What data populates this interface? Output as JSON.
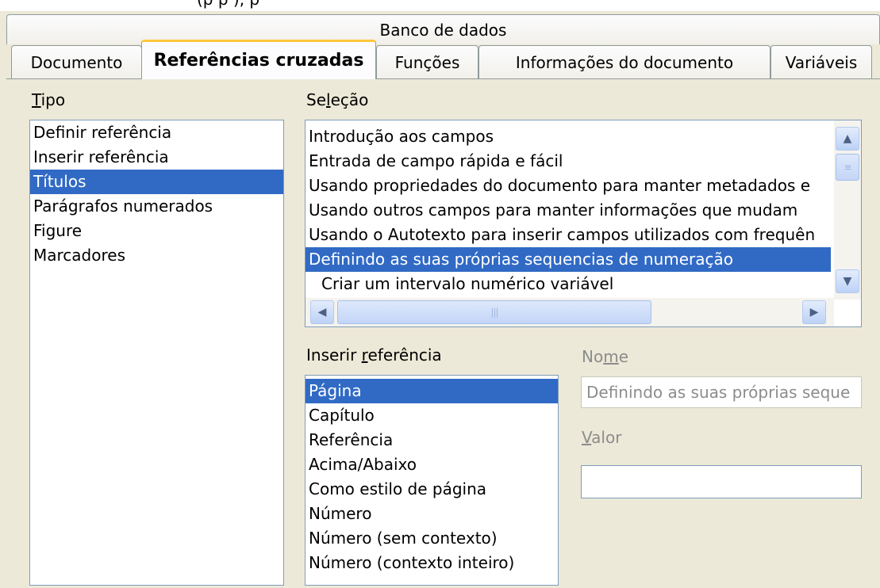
{
  "top_text": "(p                        p                 ),                                                                                               p",
  "tabs_row1": [
    "Banco de dados"
  ],
  "tabs_row2": [
    "Documento",
    "Referências cruzadas",
    "Funções",
    "Informações do documento",
    "Variáveis"
  ],
  "tipo": {
    "label_first": "T",
    "label_rest": "ipo",
    "items": [
      "Definir referência",
      "Inserir referência",
      "Títulos",
      "Parágrafos numerados",
      "Figure",
      "Marcadores"
    ],
    "selected_index": 2
  },
  "selecao": {
    "label_a": "Se",
    "label_u": "l",
    "label_b": "eção",
    "items": [
      "Introdução aos campos",
      "Entrada de campo rápida e fácil",
      "Usando propriedades do documento para manter metadados e",
      "Usando outros campos para manter informações que mudam",
      "Usando o Autotexto para inserir campos utilizados com frequên",
      "Definindo as suas próprias sequencias de numeração",
      "Criar um intervalo numérico variável"
    ],
    "selected_index": 5
  },
  "inserir_ref": {
    "label_a": "Inserir ",
    "label_u": "r",
    "label_b": "eferência",
    "items": [
      "Página",
      "Capítulo",
      "Referência",
      "Acima/Abaixo",
      "Como estilo de página",
      "Número",
      "Número (sem contexto)",
      "Número (contexto inteiro)"
    ],
    "selected_index": 0
  },
  "nome": {
    "label_a": "No",
    "label_u": "m",
    "label_b": "e",
    "value": "Definindo as suas próprias seque"
  },
  "valor": {
    "label_u": "V",
    "label_b": "alor",
    "value": ""
  }
}
